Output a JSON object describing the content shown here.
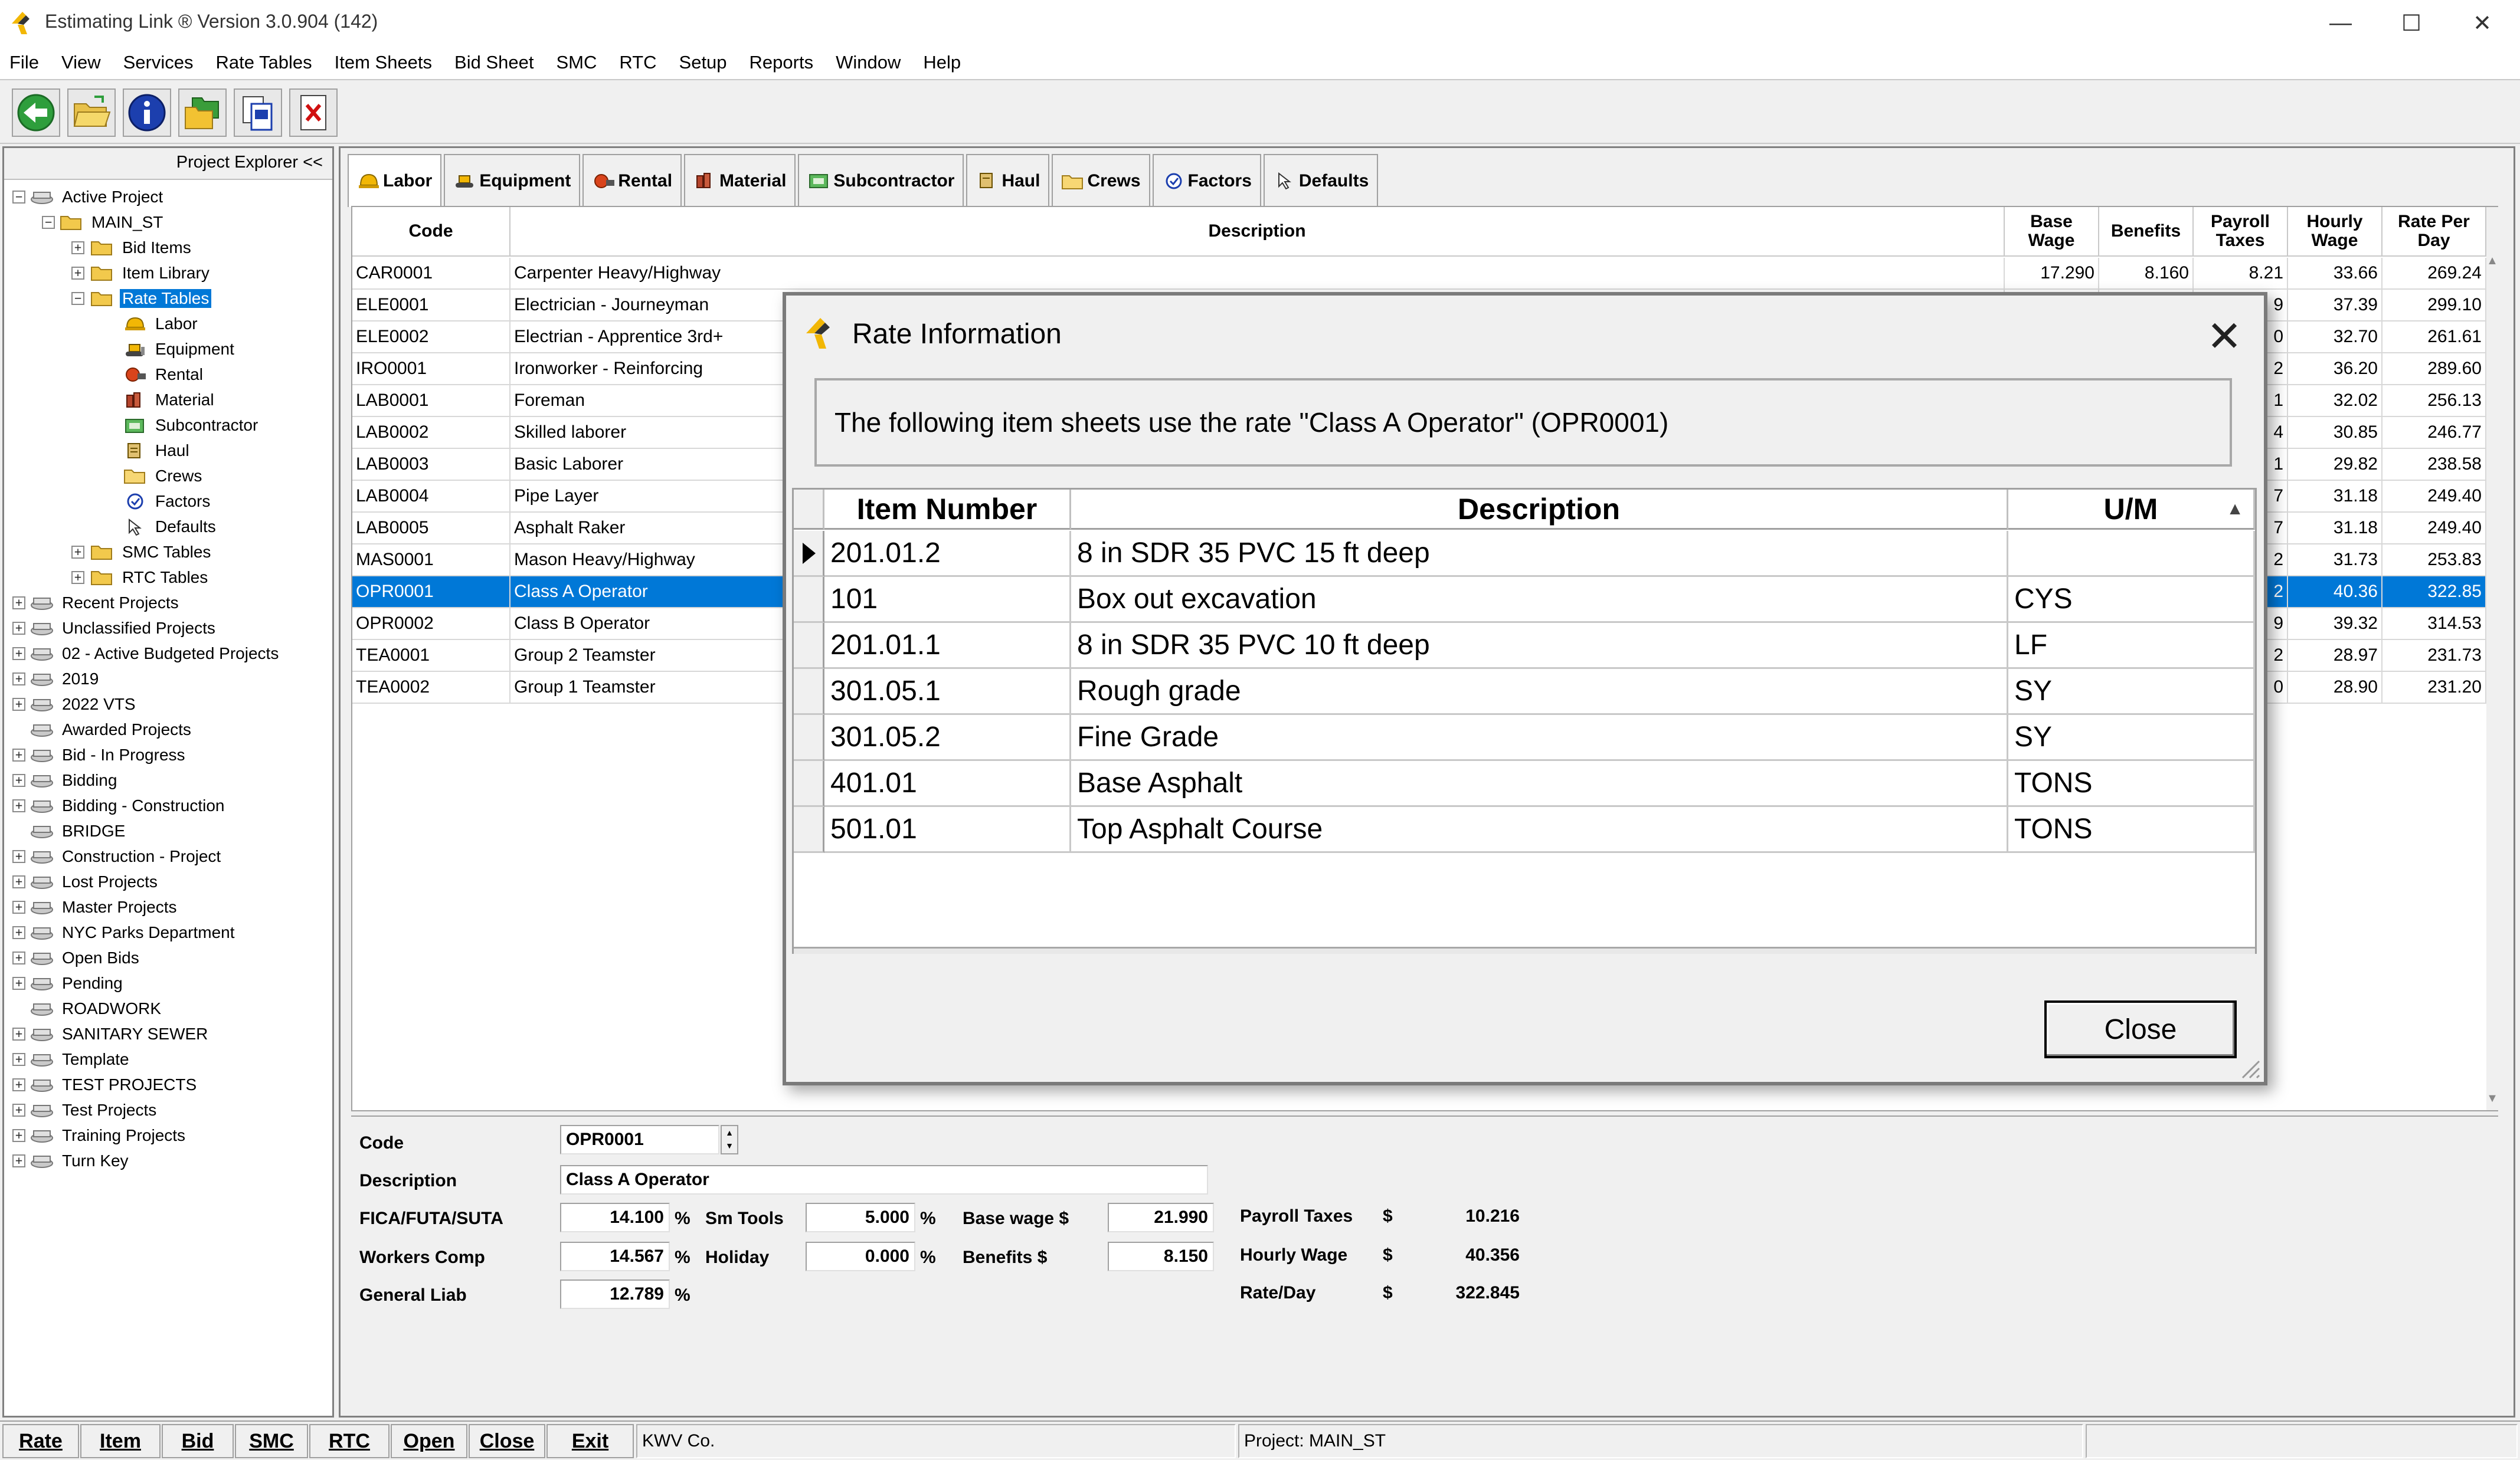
{
  "window": {
    "title": "Estimating Link ® Version   3.0.904 (142)",
    "minimize": "—",
    "maximize": "☐",
    "close": "✕"
  },
  "menu": [
    "File",
    "View",
    "Services",
    "Rate Tables",
    "Item Sheets",
    "Bid Sheet",
    "SMC",
    "RTC",
    "Setup",
    "Reports",
    "Window",
    "Help"
  ],
  "toolbar": {
    "icons": [
      "back-icon",
      "open-folder-icon",
      "info-icon",
      "folders-icon",
      "document-copy-icon",
      "delete-document-icon"
    ]
  },
  "explorer": {
    "header": "Project Explorer <<",
    "active_project": "Active Project",
    "project": "MAIN_ST",
    "project_children": [
      "Bid Items",
      "Item Library",
      "Rate Tables"
    ],
    "rate_tables_children": [
      "Labor",
      "Equipment",
      "Rental",
      "Material",
      "Subcontractor",
      "Haul",
      "Crews",
      "Factors",
      "Defaults"
    ],
    "other_tables": [
      "SMC Tables",
      "RTC Tables"
    ],
    "folders": [
      "Recent Projects",
      "Unclassified Projects",
      "02 - Active Budgeted Projects",
      "2019",
      "2022 VTS",
      "Awarded Projects",
      "Bid - In Progress",
      "Bidding",
      "Bidding - Construction",
      "BRIDGE",
      "Construction - Project",
      "Lost Projects",
      "Master Projects",
      "NYC Parks Department",
      "Open Bids",
      "Pending",
      "ROADWORK",
      "SANITARY SEWER",
      "Template",
      "TEST PROJECTS",
      "Test Projects",
      "Training Projects",
      "Turn Key"
    ]
  },
  "tabs": [
    "Labor",
    "Equipment",
    "Rental",
    "Material",
    "Subcontractor",
    "Haul",
    "Crews",
    "Factors",
    "Defaults"
  ],
  "grid": {
    "headers": {
      "code": "Code",
      "description": "Description",
      "base_wage": "Base Wage",
      "benefits": "Benefits",
      "payroll_taxes": "Payroll Taxes",
      "hourly_wage": "Hourly Wage",
      "rate_per_day": "Rate Per Day"
    },
    "rows": [
      {
        "code": "CAR0001",
        "description": "Carpenter Heavy/Highway",
        "base_wage": "17.290",
        "benefits": "8.160",
        "payroll_taxes": "8.21",
        "hourly_wage": "33.66",
        "rate_per_day": "269.24"
      },
      {
        "code": "ELE0001",
        "description": "Electrician - Journeyman",
        "base_wage": "",
        "benefits": "",
        "payroll_taxes": "9",
        "hourly_wage": "37.39",
        "rate_per_day": "299.10"
      },
      {
        "code": "ELE0002",
        "description": "Electrian - Apprentice 3rd+",
        "base_wage": "",
        "benefits": "",
        "payroll_taxes": "0",
        "hourly_wage": "32.70",
        "rate_per_day": "261.61"
      },
      {
        "code": "IRO0001",
        "description": "Ironworker - Reinforcing",
        "base_wage": "",
        "benefits": "",
        "payroll_taxes": "2",
        "hourly_wage": "36.20",
        "rate_per_day": "289.60"
      },
      {
        "code": "LAB0001",
        "description": "Foreman",
        "base_wage": "",
        "benefits": "",
        "payroll_taxes": "1",
        "hourly_wage": "32.02",
        "rate_per_day": "256.13"
      },
      {
        "code": "LAB0002",
        "description": "Skilled laborer",
        "base_wage": "",
        "benefits": "",
        "payroll_taxes": "4",
        "hourly_wage": "30.85",
        "rate_per_day": "246.77"
      },
      {
        "code": "LAB0003",
        "description": "Basic Laborer",
        "base_wage": "",
        "benefits": "",
        "payroll_taxes": "1",
        "hourly_wage": "29.82",
        "rate_per_day": "238.58"
      },
      {
        "code": "LAB0004",
        "description": "Pipe Layer",
        "base_wage": "",
        "benefits": "",
        "payroll_taxes": "7",
        "hourly_wage": "31.18",
        "rate_per_day": "249.40"
      },
      {
        "code": "LAB0005",
        "description": "Asphalt Raker",
        "base_wage": "",
        "benefits": "",
        "payroll_taxes": "7",
        "hourly_wage": "31.18",
        "rate_per_day": "249.40"
      },
      {
        "code": "MAS0001",
        "description": "Mason Heavy/Highway",
        "base_wage": "",
        "benefits": "",
        "payroll_taxes": "2",
        "hourly_wage": "31.73",
        "rate_per_day": "253.83"
      },
      {
        "code": "OPR0001",
        "description": "Class A Operator",
        "base_wage": "",
        "benefits": "",
        "payroll_taxes": "2",
        "hourly_wage": "40.36",
        "rate_per_day": "322.85"
      },
      {
        "code": "OPR0002",
        "description": "Class B Operator",
        "base_wage": "",
        "benefits": "",
        "payroll_taxes": "9",
        "hourly_wage": "39.32",
        "rate_per_day": "314.53"
      },
      {
        "code": "TEA0001",
        "description": "Group 2 Teamster",
        "base_wage": "",
        "benefits": "",
        "payroll_taxes": "2",
        "hourly_wage": "28.97",
        "rate_per_day": "231.73"
      },
      {
        "code": "TEA0002",
        "description": "Group 1 Teamster",
        "base_wage": "",
        "benefits": "",
        "payroll_taxes": "0",
        "hourly_wage": "28.90",
        "rate_per_day": "231.20"
      }
    ],
    "selected_index": 10,
    "scroll_up": "▲",
    "scroll_down": "▼"
  },
  "detail": {
    "code_label": "Code",
    "code_value": "OPR0001",
    "description_label": "Description",
    "description_value": "Class A Operator",
    "fica_label": "FICA/FUTA/SUTA",
    "fica_value": "14.100",
    "workers_comp_label": "Workers Comp",
    "workers_comp_value": "14.567",
    "general_liab_label": "General Liab",
    "general_liab_value": "12.789",
    "sm_tools_label": "Sm Tools",
    "sm_tools_value": "5.000",
    "holiday_label": "Holiday",
    "holiday_value": "0.000",
    "base_wage_label": "Base wage $",
    "base_wage_value": "21.990",
    "benefits_label": "Benefits $",
    "benefits_value": "8.150",
    "payroll_taxes_label": "Payroll Taxes",
    "payroll_taxes_value": "10.216",
    "hourly_wage_label": "Hourly Wage",
    "hourly_wage_value": "40.356",
    "rate_day_label": "Rate/Day",
    "rate_day_value": "322.845",
    "percent": "%",
    "dollar": "$"
  },
  "statusbar": {
    "buttons": [
      "Rate",
      "Item",
      "Bid",
      "SMC",
      "RTC",
      "Open",
      "Close",
      "Exit"
    ],
    "company": "KWV Co.",
    "project": "Project: MAIN_ST"
  },
  "modal": {
    "title": "Rate Information",
    "message": "The following item sheets use the rate \"Class A Operator\" (OPR0001)",
    "headers": {
      "item_number": "Item Number",
      "description": "Description",
      "um": "U/M"
    },
    "rows": [
      {
        "item_number": "201.01.2",
        "description": "8 in SDR 35 PVC 15 ft deep",
        "um": ""
      },
      {
        "item_number": "101",
        "description": "Box out excavation",
        "um": "CYS"
      },
      {
        "item_number": "201.01.1",
        "description": "8 in SDR 35 PVC 10 ft deep",
        "um": "LF"
      },
      {
        "item_number": "301.05.1",
        "description": "Rough grade",
        "um": "SY"
      },
      {
        "item_number": "301.05.2",
        "description": "Fine Grade",
        "um": "SY"
      },
      {
        "item_number": "401.01",
        "description": "Base Asphalt",
        "um": "TONS"
      },
      {
        "item_number": "501.01",
        "description": "Top Asphalt Course",
        "um": "TONS"
      }
    ],
    "close_label": "Close",
    "close_x": "✕",
    "sort_arrow": "▲"
  },
  "colors": {
    "selection": "#0078d7"
  }
}
